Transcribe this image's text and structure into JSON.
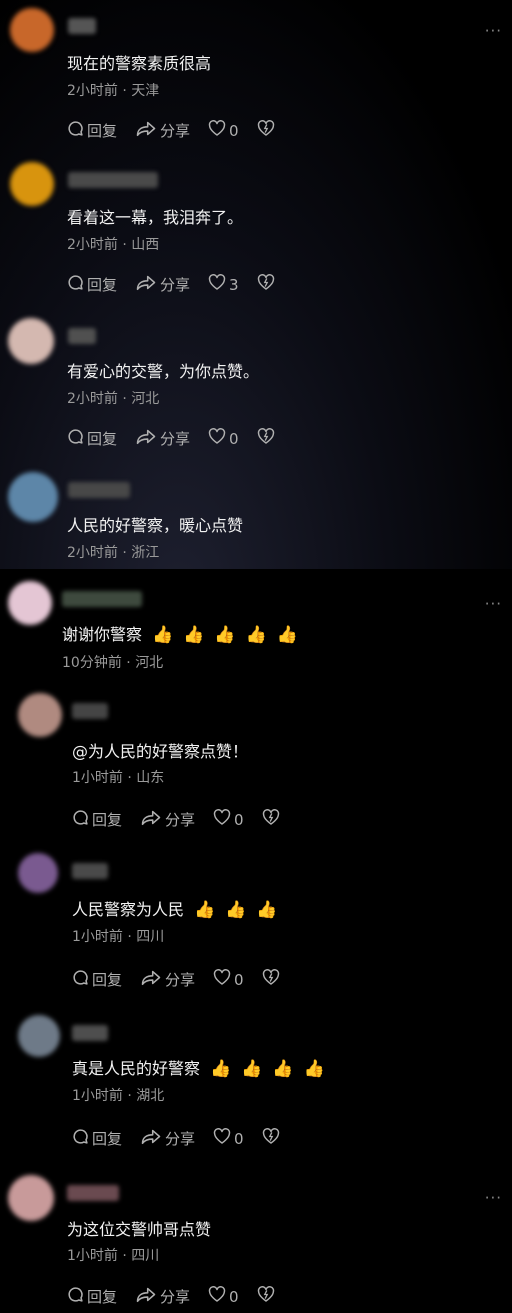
{
  "actions": {
    "reply": "回复",
    "share": "分享"
  },
  "more_glyph": "···",
  "thumb_glyph": "👍",
  "comments": [
    {
      "text": "现在的警察素质很高",
      "time": "2小时前",
      "region": "天津",
      "likes": "0",
      "avatar_color": "#c8672a",
      "name_color": "#555555"
    },
    {
      "text": "看着这一幕，我泪奔了。",
      "time": "2小时前",
      "region": "山西",
      "likes": "3",
      "avatar_color": "#d8940e",
      "name_color": "#4a4a4a"
    },
    {
      "text": "有爱心的交警，为你点赞。",
      "time": "2小时前",
      "region": "河北",
      "likes": "0",
      "avatar_color": "#d4b8b0",
      "name_color": "#505050"
    },
    {
      "text": "人民的好警察，暖心点赞",
      "time": "2小时前",
      "region": "浙江",
      "avatar_color": "#5d86a8",
      "name_color": "#484848"
    },
    {
      "text": "谢谢你警察",
      "time": "10分钟前",
      "region": "河北",
      "thumb_count": 5,
      "avatar_color": "#e4c6d4",
      "name_color": "#3e4a3e"
    },
    {
      "text": "@为人民的好警察点赞！",
      "time": "1小时前",
      "region": "山东",
      "likes": "0",
      "avatar_color": "#b08a80",
      "name_color": "#454545"
    },
    {
      "text": "人民警察为人民",
      "time": "1小时前",
      "region": "四川",
      "likes": "0",
      "thumb_count": 3,
      "avatar_color": "#7a5a90",
      "name_color": "#4a4a4a"
    },
    {
      "text": "真是人民的好警察",
      "time": "1小时前",
      "region": "湖北",
      "likes": "0",
      "thumb_count": 4,
      "avatar_color": "#6e7a88",
      "name_color": "#4e4e4e"
    },
    {
      "text": "为这位交警帅哥点赞",
      "time": "1小时前",
      "region": "四川",
      "likes": "0",
      "avatar_color": "#c89a9a",
      "name_color": "#6a4a50"
    }
  ]
}
